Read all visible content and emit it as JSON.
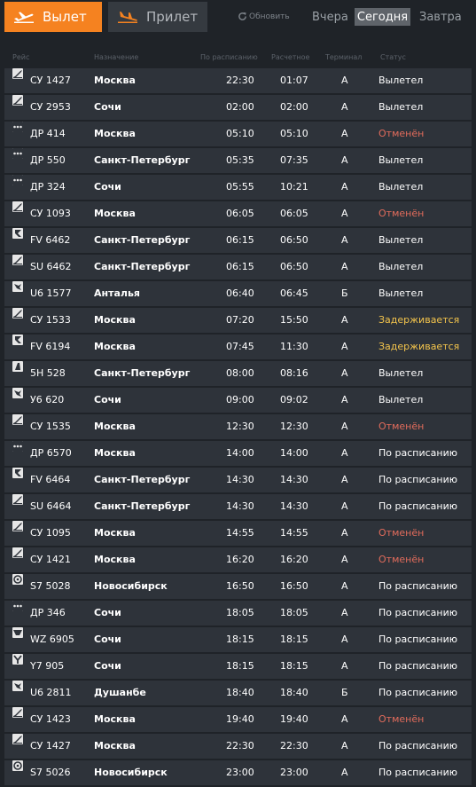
{
  "tabs": {
    "departures_label": "Вылет",
    "arrivals_label": "Прилет"
  },
  "refresh_label": "Обновить",
  "days": {
    "yesterday": "Вчера",
    "today": "Сегодня",
    "tomorrow": "Завтра",
    "selected": "today"
  },
  "columns": {
    "flight": "Рейс",
    "destination": "Назначение",
    "scheduled": "По расписанию",
    "estimated": "Расчетное",
    "terminal": "Терминал",
    "status": "Статус"
  },
  "colors": {
    "accent": "#f58220",
    "cancelled": "#e36c5c",
    "delayed": "#f3c44c",
    "row_bg": "#2e333a",
    "page_bg": "#1f2328"
  },
  "flights": [
    {
      "icon": "su",
      "flight": "СУ 1427",
      "destination": "Москва",
      "scheduled": "22:30",
      "estimated": "01:07",
      "terminal": "A",
      "status": "Вылетел",
      "status_type": "departed"
    },
    {
      "icon": "su",
      "flight": "СУ 2953",
      "destination": "Сочи",
      "scheduled": "02:00",
      "estimated": "02:00",
      "terminal": "A",
      "status": "Вылетел",
      "status_type": "departed"
    },
    {
      "icon": "dots",
      "flight": "ДР 414",
      "destination": "Москва",
      "scheduled": "05:10",
      "estimated": "05:10",
      "terminal": "A",
      "status": "Отменён",
      "status_type": "cancelled"
    },
    {
      "icon": "dots",
      "flight": "ДР 550",
      "destination": "Санкт-Петербург",
      "scheduled": "05:35",
      "estimated": "07:35",
      "terminal": "A",
      "status": "Вылетел",
      "status_type": "departed"
    },
    {
      "icon": "dots",
      "flight": "ДР 324",
      "destination": "Сочи",
      "scheduled": "05:55",
      "estimated": "10:21",
      "terminal": "A",
      "status": "Вылетел",
      "status_type": "departed"
    },
    {
      "icon": "su",
      "flight": "СУ 1093",
      "destination": "Москва",
      "scheduled": "06:05",
      "estimated": "06:05",
      "terminal": "A",
      "status": "Отменён",
      "status_type": "cancelled"
    },
    {
      "icon": "fv",
      "flight": "FV 6462",
      "destination": "Санкт-Петербург",
      "scheduled": "06:15",
      "estimated": "06:50",
      "terminal": "A",
      "status": "Вылетел",
      "status_type": "departed"
    },
    {
      "icon": "su",
      "flight": "SU 6462",
      "destination": "Санкт-Петербург",
      "scheduled": "06:15",
      "estimated": "06:50",
      "terminal": "A",
      "status": "Вылетел",
      "status_type": "departed"
    },
    {
      "icon": "u6",
      "flight": "U6 1577",
      "destination": "Анталья",
      "scheduled": "06:40",
      "estimated": "06:45",
      "terminal": "Б",
      "status": "Вылетел",
      "status_type": "departed"
    },
    {
      "icon": "su",
      "flight": "СУ 1533",
      "destination": "Москва",
      "scheduled": "07:20",
      "estimated": "15:50",
      "terminal": "A",
      "status": "Задерживается",
      "status_type": "delayed"
    },
    {
      "icon": "fv",
      "flight": "FV 6194",
      "destination": "Москва",
      "scheduled": "07:45",
      "estimated": "11:30",
      "terminal": "A",
      "status": "Задерживается",
      "status_type": "delayed"
    },
    {
      "icon": "5h",
      "flight": "5H 528",
      "destination": "Санкт-Петербург",
      "scheduled": "08:00",
      "estimated": "08:16",
      "terminal": "A",
      "status": "Вылетел",
      "status_type": "departed"
    },
    {
      "icon": "u6",
      "flight": "У6 620",
      "destination": "Сочи",
      "scheduled": "09:00",
      "estimated": "09:02",
      "terminal": "A",
      "status": "Вылетел",
      "status_type": "departed"
    },
    {
      "icon": "su",
      "flight": "СУ 1535",
      "destination": "Москва",
      "scheduled": "12:30",
      "estimated": "12:30",
      "terminal": "A",
      "status": "Отменён",
      "status_type": "cancelled"
    },
    {
      "icon": "dots",
      "flight": "ДР 6570",
      "destination": "Москва",
      "scheduled": "14:00",
      "estimated": "14:00",
      "terminal": "A",
      "status": "По расписанию",
      "status_type": "ontime"
    },
    {
      "icon": "fv",
      "flight": "FV 6464",
      "destination": "Санкт-Петербург",
      "scheduled": "14:30",
      "estimated": "14:30",
      "terminal": "A",
      "status": "По расписанию",
      "status_type": "ontime"
    },
    {
      "icon": "su",
      "flight": "SU 6464",
      "destination": "Санкт-Петербург",
      "scheduled": "14:30",
      "estimated": "14:30",
      "terminal": "A",
      "status": "По расписанию",
      "status_type": "ontime"
    },
    {
      "icon": "su",
      "flight": "СУ 1095",
      "destination": "Москва",
      "scheduled": "14:55",
      "estimated": "14:55",
      "terminal": "A",
      "status": "Отменён",
      "status_type": "cancelled"
    },
    {
      "icon": "su",
      "flight": "СУ 1421",
      "destination": "Москва",
      "scheduled": "16:20",
      "estimated": "16:20",
      "terminal": "A",
      "status": "Отменён",
      "status_type": "cancelled"
    },
    {
      "icon": "s7",
      "flight": "S7 5028",
      "destination": "Новосибирск",
      "scheduled": "16:50",
      "estimated": "16:50",
      "terminal": "A",
      "status": "По расписанию",
      "status_type": "ontime"
    },
    {
      "icon": "dots",
      "flight": "ДР 346",
      "destination": "Сочи",
      "scheduled": "18:05",
      "estimated": "18:05",
      "terminal": "A",
      "status": "По расписанию",
      "status_type": "ontime"
    },
    {
      "icon": "wz",
      "flight": "WZ 6905",
      "destination": "Сочи",
      "scheduled": "18:15",
      "estimated": "18:15",
      "terminal": "A",
      "status": "По расписанию",
      "status_type": "ontime"
    },
    {
      "icon": "y7",
      "flight": "Y7 905",
      "destination": "Сочи",
      "scheduled": "18:15",
      "estimated": "18:15",
      "terminal": "A",
      "status": "По расписанию",
      "status_type": "ontime"
    },
    {
      "icon": "u6",
      "flight": "U6 2811",
      "destination": "Душанбе",
      "scheduled": "18:40",
      "estimated": "18:40",
      "terminal": "Б",
      "status": "По расписанию",
      "status_type": "ontime"
    },
    {
      "icon": "su",
      "flight": "СУ 1423",
      "destination": "Москва",
      "scheduled": "19:40",
      "estimated": "19:40",
      "terminal": "A",
      "status": "Отменён",
      "status_type": "cancelled"
    },
    {
      "icon": "su",
      "flight": "СУ 1427",
      "destination": "Москва",
      "scheduled": "22:30",
      "estimated": "22:30",
      "terminal": "A",
      "status": "По расписанию",
      "status_type": "ontime"
    },
    {
      "icon": "s7",
      "flight": "S7 5026",
      "destination": "Новосибирск",
      "scheduled": "23:00",
      "estimated": "23:00",
      "terminal": "A",
      "status": "По расписанию",
      "status_type": "ontime"
    }
  ]
}
